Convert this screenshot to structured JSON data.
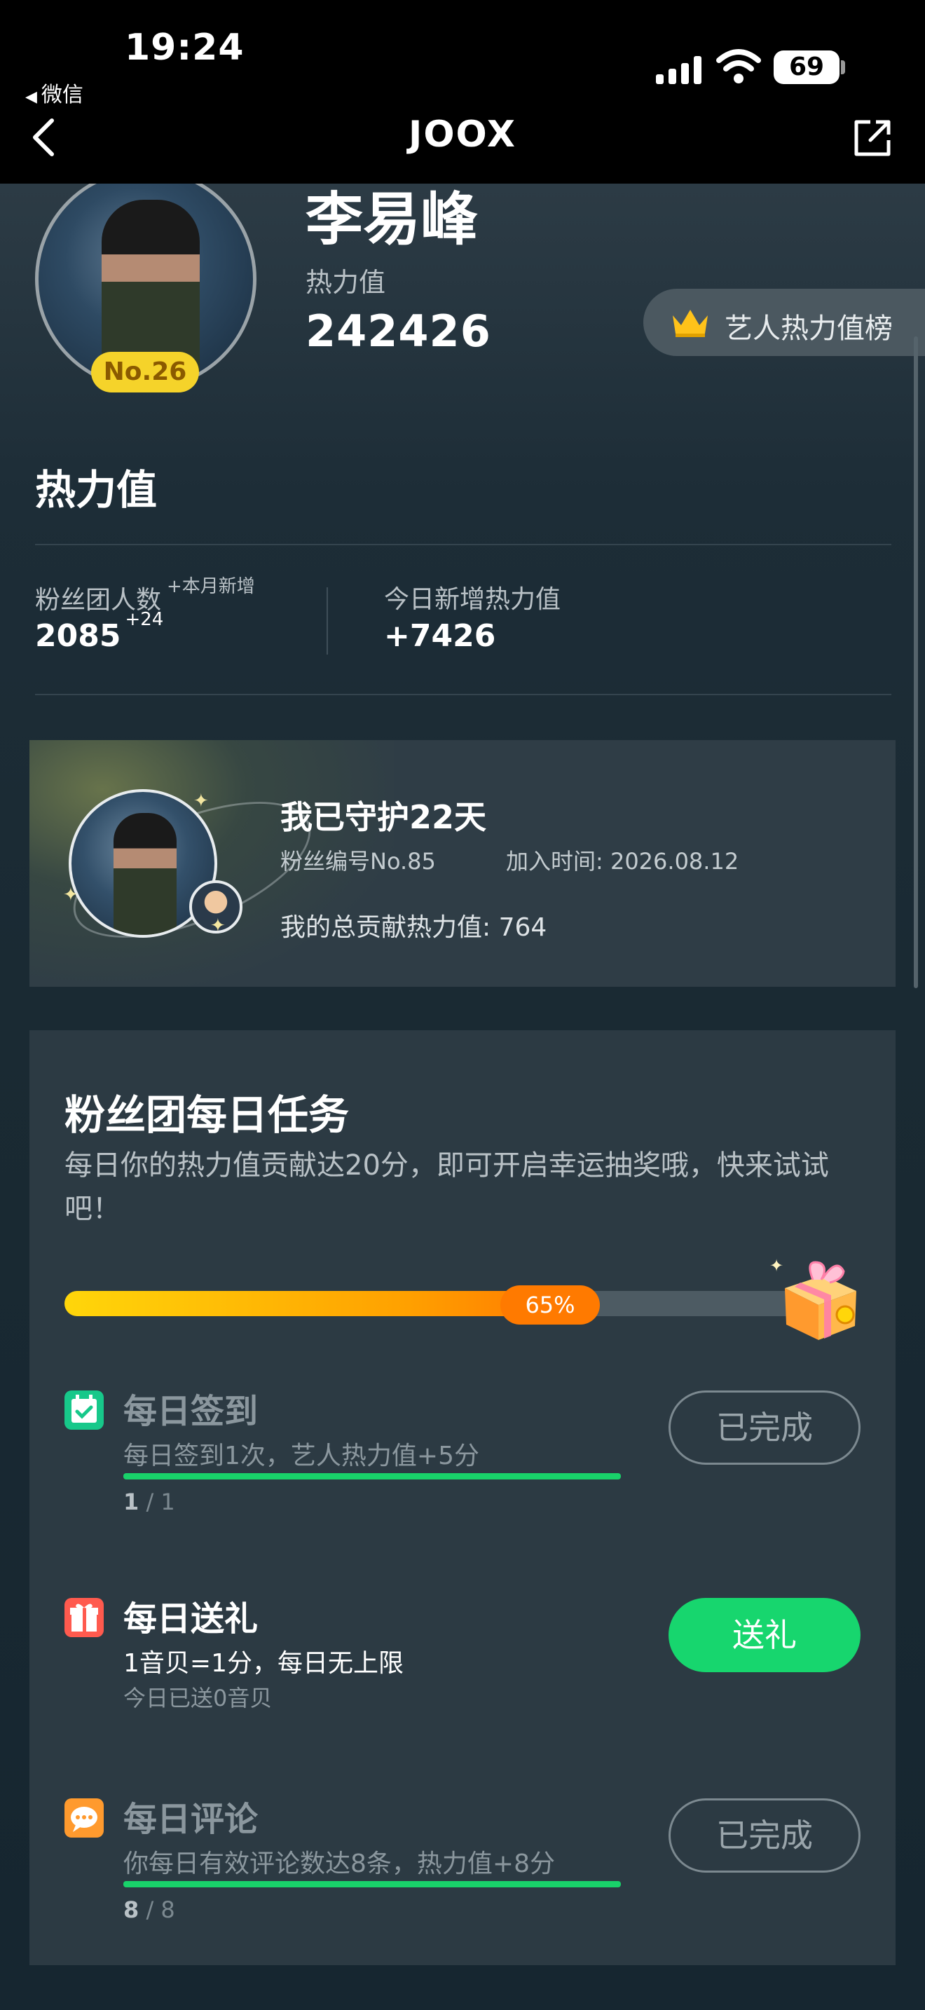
{
  "status_bar": {
    "time": "19:24",
    "back_app": "微信",
    "battery": "69"
  },
  "nav": {
    "title": "JOOX"
  },
  "artist": {
    "name": "李易峰",
    "heat_label": "热力值",
    "heat_value": "242426",
    "rank": "No.26",
    "ranking_button": "艺人热力值榜"
  },
  "heat_section": {
    "title": "热力值",
    "fans_label": "粉丝团人数",
    "fans_label_sup": "+本月新增",
    "fans_value": "2085",
    "fans_value_sup": "+24",
    "today_label": "今日新增热力值",
    "today_value": "+7426"
  },
  "guard": {
    "title": "我已守护22天",
    "fan_number": "粉丝编号No.85",
    "join_time": "加入时间: 2026.08.12",
    "total": "我的总贡献热力值: 764"
  },
  "tasks": {
    "title": "粉丝团每日任务",
    "description": "每日你的热力值贡献达20分，即可开启幸运抽奖哦，快来试试吧！",
    "progress_percent": 65,
    "progress_label": "65%",
    "items": [
      {
        "name": "每日签到",
        "line1": "每日签到1次，艺人热力值+5分",
        "count_done": "1",
        "count_sep": " / ",
        "count_total": "1",
        "progress": 1,
        "button": "已完成"
      },
      {
        "name": "每日送礼",
        "line1": "1音贝=1分，每日无上限",
        "line2": "今日已送0音贝",
        "button": "送礼"
      },
      {
        "name": "每日评论",
        "line1": "你每日有效评论数达8条，热力值+8分",
        "count_done": "8",
        "count_sep": " / ",
        "count_total": "8",
        "progress": 1,
        "button": "已完成"
      }
    ]
  },
  "colors": {
    "accent_green": "#17d66e",
    "progress_orange": "#ff7a00",
    "badge_yellow": "#f5d32a"
  }
}
